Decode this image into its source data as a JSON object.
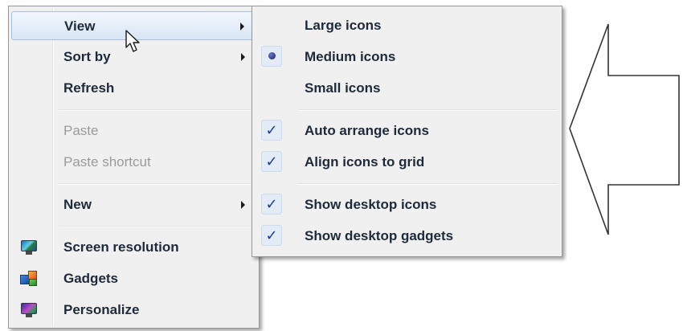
{
  "context_menu": {
    "items": [
      {
        "label": "View",
        "enabled": true,
        "submenu": true,
        "highlighted": true
      },
      {
        "label": "Sort by",
        "enabled": true,
        "submenu": true
      },
      {
        "label": "Refresh",
        "enabled": true
      },
      {
        "label": "Paste",
        "enabled": false
      },
      {
        "label": "Paste shortcut",
        "enabled": false
      },
      {
        "label": "New",
        "enabled": true,
        "submenu": true
      },
      {
        "label": "Screen resolution",
        "enabled": true,
        "icon": "screen-resolution-icon"
      },
      {
        "label": "Gadgets",
        "enabled": true,
        "icon": "gadgets-icon"
      },
      {
        "label": "Personalize",
        "enabled": true,
        "icon": "personalize-icon"
      }
    ]
  },
  "view_submenu": {
    "items": [
      {
        "label": "Large icons",
        "mark": "none"
      },
      {
        "label": "Medium icons",
        "mark": "radio"
      },
      {
        "label": "Small icons",
        "mark": "none"
      },
      {
        "label": "Auto arrange icons",
        "mark": "check"
      },
      {
        "label": "Align icons to grid",
        "mark": "check"
      },
      {
        "label": "Show desktop icons",
        "mark": "check"
      },
      {
        "label": "Show desktop gadgets",
        "mark": "check"
      }
    ]
  },
  "marks": {
    "check_glyph": "✓",
    "check_color": "#1a3a9a",
    "submenu_arrow_icon": "chevron-right-icon",
    "cursor_icon": "mouse-pointer-icon",
    "annotation_icon": "left-arrow-outline-icon"
  },
  "colors": {
    "menu_background": "#f0f0f0",
    "highlight_border": "#a7c0e0",
    "disabled_text": "#9a9a9a",
    "text": "#1e2a3a"
  }
}
